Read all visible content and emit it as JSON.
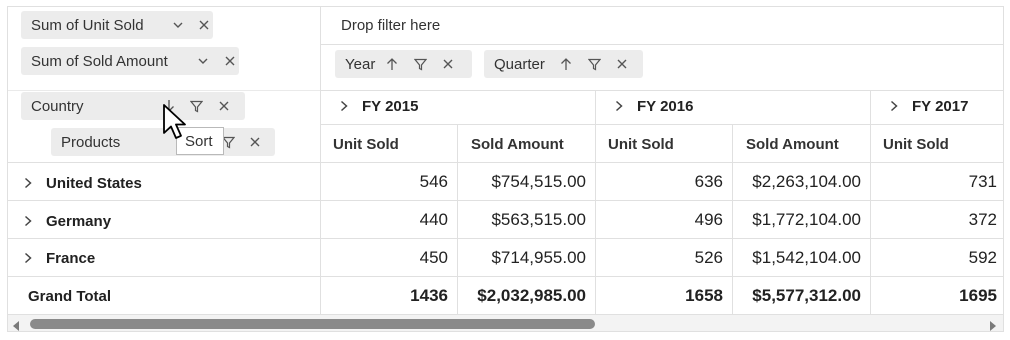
{
  "values_pills": [
    {
      "label": "Sum of Unit Sold"
    },
    {
      "label": "Sum of Sold Amount"
    }
  ],
  "filter_area": {
    "placeholder": "Drop filter here"
  },
  "column_pills": [
    {
      "label": "Year"
    },
    {
      "label": "Quarter"
    }
  ],
  "row_pills": [
    {
      "label": "Country"
    },
    {
      "label": "Products"
    }
  ],
  "tooltip": {
    "text": "Sort"
  },
  "year_headers": [
    "FY 2015",
    "FY 2016",
    "FY 2017"
  ],
  "measure_headers": [
    "Unit Sold",
    "Sold Amount",
    "Unit Sold",
    "Sold Amount",
    "Unit Sold"
  ],
  "rows": [
    {
      "label": "United States",
      "values": [
        "546",
        "$754,515.00",
        "636",
        "$2,263,104.00",
        "731"
      ]
    },
    {
      "label": "Germany",
      "values": [
        "440",
        "$563,515.00",
        "496",
        "$1,772,104.00",
        "372"
      ]
    },
    {
      "label": "France",
      "values": [
        "450",
        "$714,955.00",
        "526",
        "$1,542,104.00",
        "592"
      ]
    }
  ],
  "grand_total": {
    "label": "Grand Total",
    "values": [
      "1436",
      "$2,032,985.00",
      "1658",
      "$5,577,312.00",
      "1695"
    ]
  },
  "icons": {
    "dropdown": "chevron-down-icon",
    "close": "close-icon",
    "sort": "sort-arrow-icon",
    "filter": "filter-icon",
    "expand": "chevron-right-icon",
    "cursor": "mouse-pointer-icon"
  }
}
